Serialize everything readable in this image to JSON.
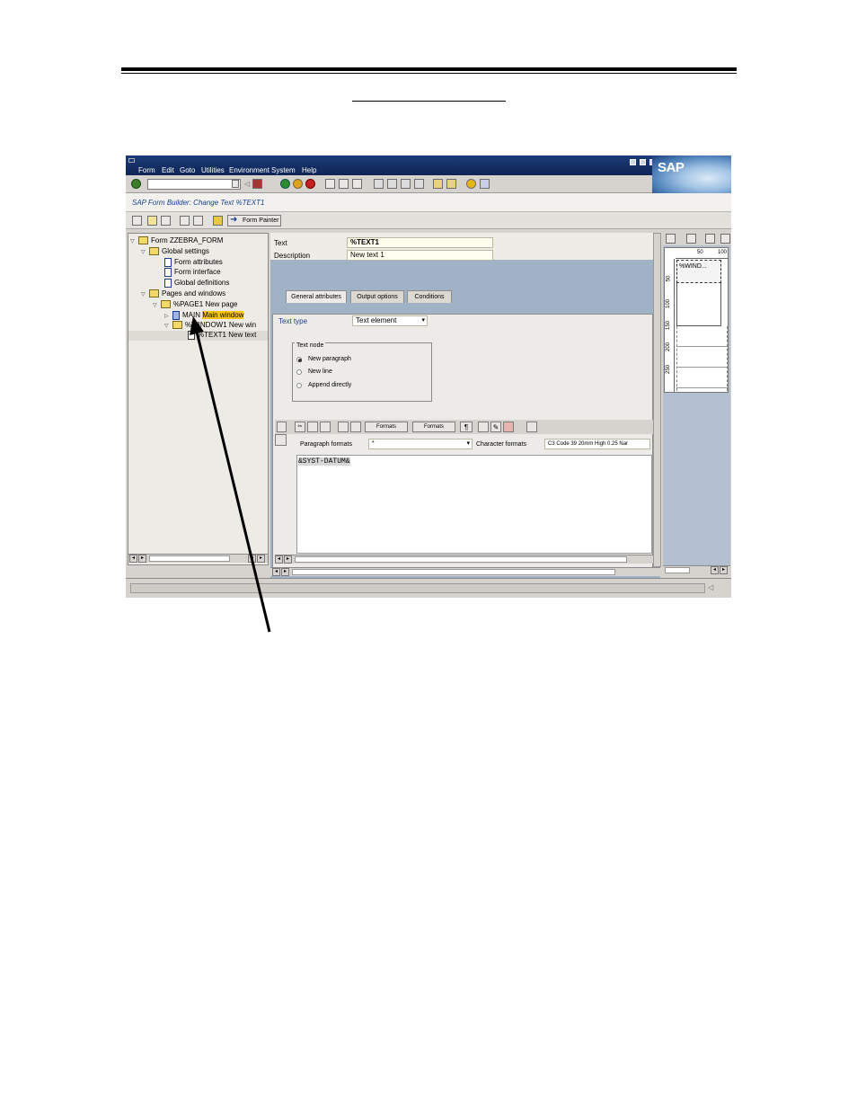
{
  "screen": {
    "menu": [
      "Form",
      "Edit",
      "Goto",
      "Utilities",
      "Environment",
      "System",
      "Help"
    ],
    "logo": "SAP",
    "title": "SAP Form Builder: Change Text %TEXT1",
    "app_toolbar": {
      "form_painter_label": "Form Painter"
    }
  },
  "tree": {
    "root": "Form ZZEBRA_FORM",
    "global_settings": "Global settings",
    "form_attributes": "Form attributes",
    "form_interface": "Form interface",
    "global_definitions": "Global definitions",
    "pages_and_windows": "Pages and windows",
    "page1_prefix": "%PAGE1",
    "page1_desc": "New page",
    "main_prefix": "MAIN",
    "main_desc": "Main window",
    "window1": "%WINDOW1 New win",
    "text1": "%TEXT1 New text"
  },
  "header_fields": {
    "text_label": "Text",
    "text_value": "%TEXT1",
    "description_label": "Description",
    "description_value": "New text 1"
  },
  "tabs": [
    "General attributes",
    "Output options",
    "Conditions"
  ],
  "general": {
    "text_type_label": "Text type",
    "text_type_value": "Text element",
    "text_node_group": "Text node",
    "options": [
      "New paragraph",
      "New line",
      "Append directly"
    ],
    "selected_option": "New paragraph"
  },
  "editor": {
    "formats_btn_1": "Formats",
    "formats_btn_2": "Formats",
    "paragraph_formats_label": "Paragraph formats",
    "paragraph_formats_value": "*",
    "character_formats_label": "Character formats",
    "character_formats_value": "C3 Code 39 20mm High 0.25 Nar",
    "content": "&SYST-DATUM&"
  },
  "painter": {
    "ruler_top": [
      "50",
      "100"
    ],
    "ruler_left": [
      "50",
      "100",
      "150",
      "200",
      "250"
    ],
    "window_label": "%WIND..."
  },
  "colors": {
    "titlebar": "#1c3c78",
    "highlight": "#f7c317",
    "main_bg": "#9fb2c6",
    "link_blue": "#1b3c8a"
  }
}
